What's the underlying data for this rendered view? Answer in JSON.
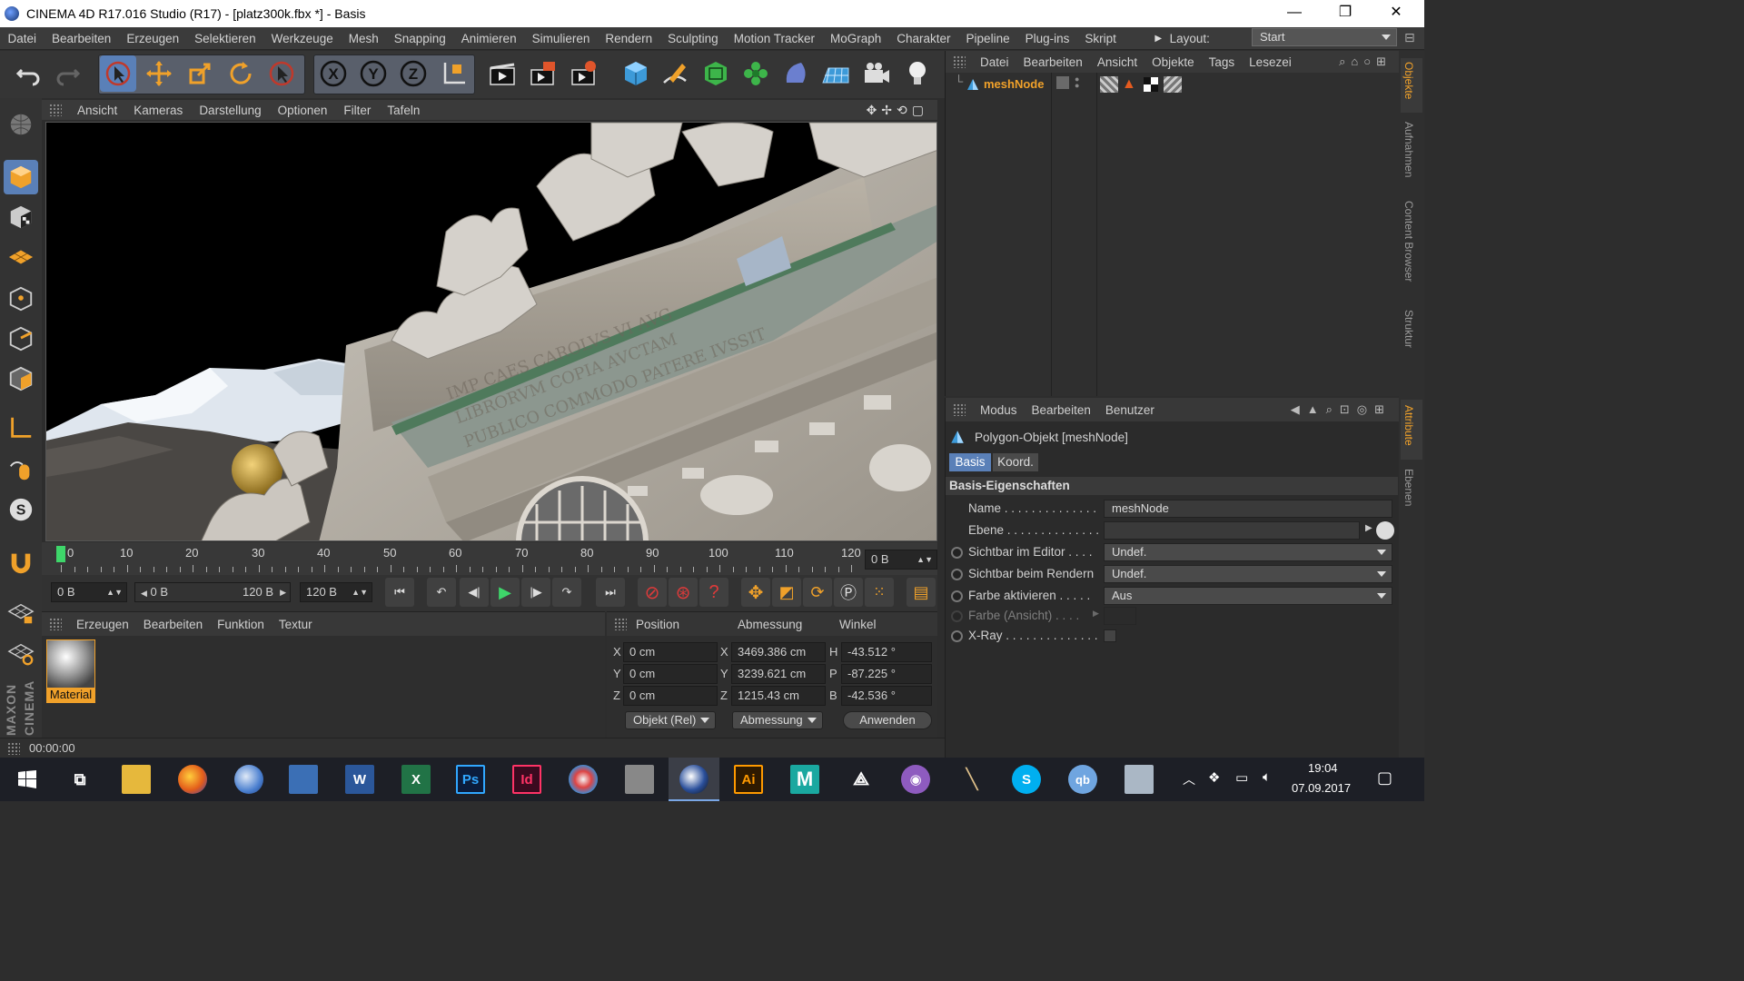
{
  "window": {
    "title": "CINEMA 4D R17.016 Studio (R17) - [platz300k.fbx *] - Basis",
    "controls": {
      "minimize": "—",
      "restore": "❐",
      "close": "✕"
    }
  },
  "menubar": {
    "items": [
      "Datei",
      "Bearbeiten",
      "Erzeugen",
      "Selektieren",
      "Werkzeuge",
      "Mesh",
      "Snapping",
      "Animieren",
      "Simulieren",
      "Rendern",
      "Sculpting",
      "Motion Tracker",
      "MoGraph",
      "Charakter",
      "Pipeline",
      "Plug-ins",
      "Skript"
    ],
    "layout_label": "Layout:",
    "layout_value": "Start"
  },
  "toolbar": {
    "icons": [
      "undo-icon",
      "redo-icon",
      "live-selection-icon",
      "move-icon",
      "scale-icon",
      "rotate-icon",
      "select-icon",
      "x-axis-icon",
      "y-axis-icon",
      "z-axis-icon",
      "coordinate-system-icon",
      "render-view-icon",
      "render-picture-viewer-icon",
      "render-settings-icon",
      "cube-icon",
      "pen-icon",
      "subdivision-icon",
      "cloner-icon",
      "deformer-icon",
      "floor-icon",
      "camera-icon",
      "light-icon"
    ],
    "axis_labels": {
      "x": "X",
      "y": "Y",
      "z": "Z"
    }
  },
  "viewport": {
    "menu": [
      "Ansicht",
      "Kameras",
      "Darstellung",
      "Optionen",
      "Filter",
      "Tafeln"
    ]
  },
  "timeline": {
    "ticks": [
      "0",
      "10",
      "20",
      "30",
      "40",
      "50",
      "60",
      "70",
      "80",
      "90",
      "100",
      "110",
      "120"
    ],
    "current_frame_field": "0 B",
    "start_field": "0 B",
    "range_start": "0 B",
    "range_end": "120 B",
    "end_field": "120 B"
  },
  "material_panel": {
    "menu": [
      "Erzeugen",
      "Bearbeiten",
      "Funktion",
      "Textur"
    ],
    "material_name": "Material"
  },
  "coord_panel": {
    "headers": {
      "position": "Position",
      "size": "Abmessung",
      "rotation": "Winkel"
    },
    "rows": [
      {
        "axis": "X",
        "pos": "0 cm",
        "size_axis": "X",
        "size": "3469.386 cm",
        "rot_axis": "H",
        "rot": "-43.512 °"
      },
      {
        "axis": "Y",
        "pos": "0 cm",
        "size_axis": "Y",
        "size": "3239.621 cm",
        "rot_axis": "P",
        "rot": "-87.225 °"
      },
      {
        "axis": "Z",
        "pos": "0 cm",
        "size_axis": "Z",
        "size": "1215.43 cm",
        "rot_axis": "B",
        "rot": "-42.536 °"
      }
    ],
    "mode_select": "Objekt (Rel)",
    "size_select": "Abmessung",
    "apply_button": "Anwenden"
  },
  "statusbar": {
    "time": "00:00:00"
  },
  "object_manager": {
    "menu": [
      "Datei",
      "Bearbeiten",
      "Ansicht",
      "Objekte",
      "Tags",
      "Lesezei"
    ],
    "objects": [
      {
        "name": "meshNode"
      }
    ]
  },
  "attribute_manager": {
    "menu": [
      "Modus",
      "Bearbeiten",
      "Benutzer"
    ],
    "object_title": "Polygon-Objekt [meshNode]",
    "tabs": [
      "Basis",
      "Koord."
    ],
    "section": "Basis-Eigenschaften",
    "props": [
      {
        "label": "Name . . . . . . . . . . . . . .",
        "value": "meshNode"
      },
      {
        "label": "Ebene . . . . . . . . . . . . . .",
        "value": ""
      },
      {
        "label": "Sichtbar im Editor . . . .",
        "value": "Undef."
      },
      {
        "label": "Sichtbar beim Rendern",
        "value": "Undef."
      },
      {
        "label": "Farbe aktivieren . . . . .",
        "value": "Aus"
      },
      {
        "label": "Farbe (Ansicht) . . . .",
        "value": ""
      },
      {
        "label": "X-Ray . . . . . . . . . . . . . .",
        "value": ""
      }
    ]
  },
  "side_tabs": [
    "Objekte",
    "Aufnahmen",
    "Content Browser",
    "Struktur",
    "Attribute",
    "Ebenen"
  ],
  "branding": "MAXON CINEMA",
  "taskbar": {
    "apps": [
      "start-icon",
      "task-view-icon",
      "file-explorer-icon",
      "firefox-icon",
      "thunderbird-icon",
      "network-icon",
      "word-icon",
      "excel-icon",
      "photoshop-icon",
      "indesign-icon",
      "paint-icon",
      "blank-app-icon",
      "cinema4d-icon",
      "illustrator-icon",
      "maya-icon",
      "unity-icon",
      "github-icon",
      "pen-tool-icon",
      "skype-icon",
      "qbittorrent-icon",
      "system-icon"
    ],
    "labels": {
      "word": "W",
      "excel": "X",
      "photoshop": "Ps",
      "indesign": "Id",
      "illustrator": "Ai",
      "maya": "M",
      "skype": "S",
      "qb": "qb"
    },
    "time": "19:04",
    "date": "07.09.2017"
  },
  "colors": {
    "accent": "#f0a12a",
    "selected": "#5a80b8",
    "bg": "#2d2d2d"
  }
}
